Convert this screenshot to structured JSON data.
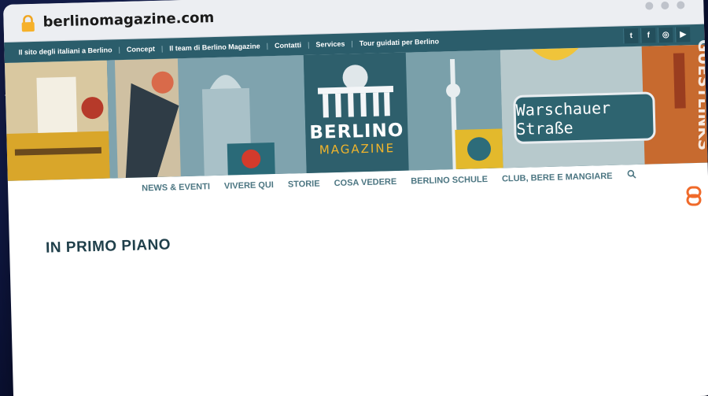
{
  "browser": {
    "url": "berlinomagazine.com",
    "lock_icon": "lock-icon",
    "window_dots": 3
  },
  "topbar": {
    "links": [
      "Il sito degli italiani a Berlino",
      "Concept",
      "Il team di Berlino Magazine",
      "Contatti",
      "Services",
      "Tour guidati per Berlino"
    ],
    "social_icons": [
      "twitter-icon",
      "facebook-icon",
      "instagram-icon",
      "youtube-icon"
    ],
    "social_glyphs": [
      "t",
      "f",
      "◎",
      "▶"
    ],
    "background_color": "#2b5d6b"
  },
  "banner": {
    "logo_title": "BERLINO",
    "logo_subtitle": "MAGAZINE",
    "sign_text": "Warschauer Straße",
    "accent_color": "#f1b52b"
  },
  "mainnav": {
    "items": [
      "NEWS & EVENTI",
      "VIVERE QUI",
      "STORIE",
      "COSA VEDERE",
      "BERLINO SCHULE",
      "CLUB, BERE E MANGIARE"
    ]
  },
  "content": {
    "section_title": "IN PRIMO PIANO"
  },
  "watermark": {
    "text": "GUESTLINKS"
  }
}
